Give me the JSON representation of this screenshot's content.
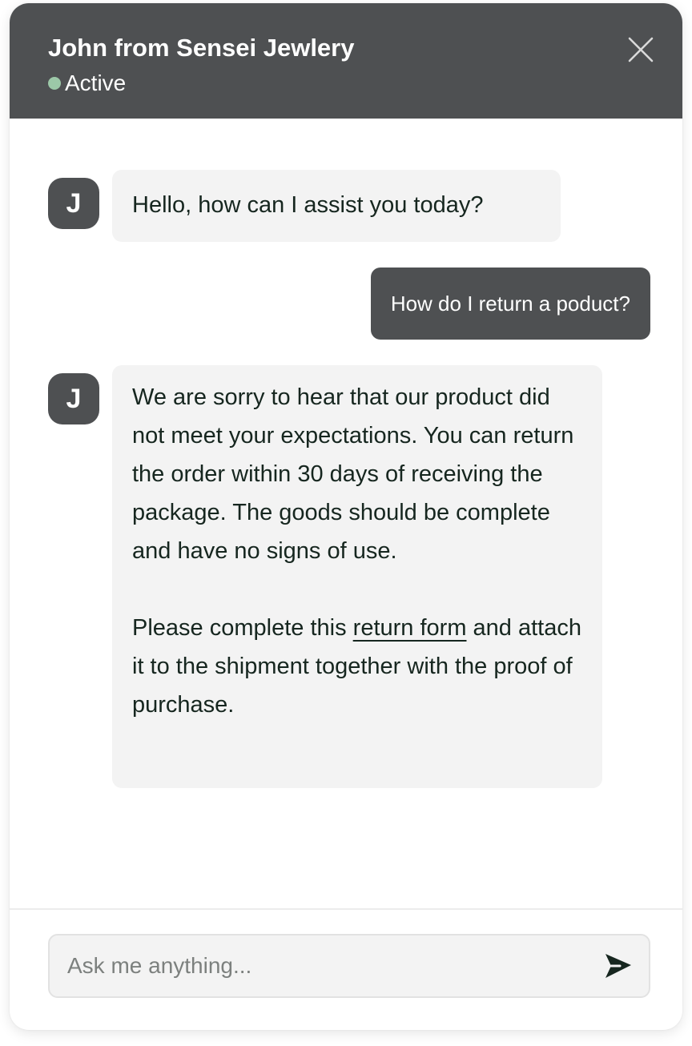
{
  "header": {
    "title": "John from Sensei Jewlery",
    "status": "Active",
    "close_icon": "close-icon"
  },
  "colors": {
    "header_bg": "#4e5052",
    "status_dot": "#9cc8a8",
    "bubble_in": "#f3f3f3",
    "text_dark": "#16261f",
    "send_icon": "#16261f"
  },
  "messages": [
    {
      "sender": "agent",
      "avatar_letter": "J",
      "text": "Hello, how can I assist you today?"
    },
    {
      "sender": "user",
      "text": "How do I return a poduct?"
    },
    {
      "sender": "agent",
      "avatar_letter": "J",
      "paragraph1": "We are sorry to hear that our product did not meet your expectations. You can return the order within 30 days of receiving the package. The goods should be complete and have no signs of use.",
      "paragraph2_before": "Please complete this ",
      "paragraph2_link": "return form",
      "paragraph2_after": " and attach it to the shipment together with the proof of purchase."
    }
  ],
  "composer": {
    "placeholder": "Ask me anything...",
    "value": "",
    "send_icon": "send-icon"
  }
}
